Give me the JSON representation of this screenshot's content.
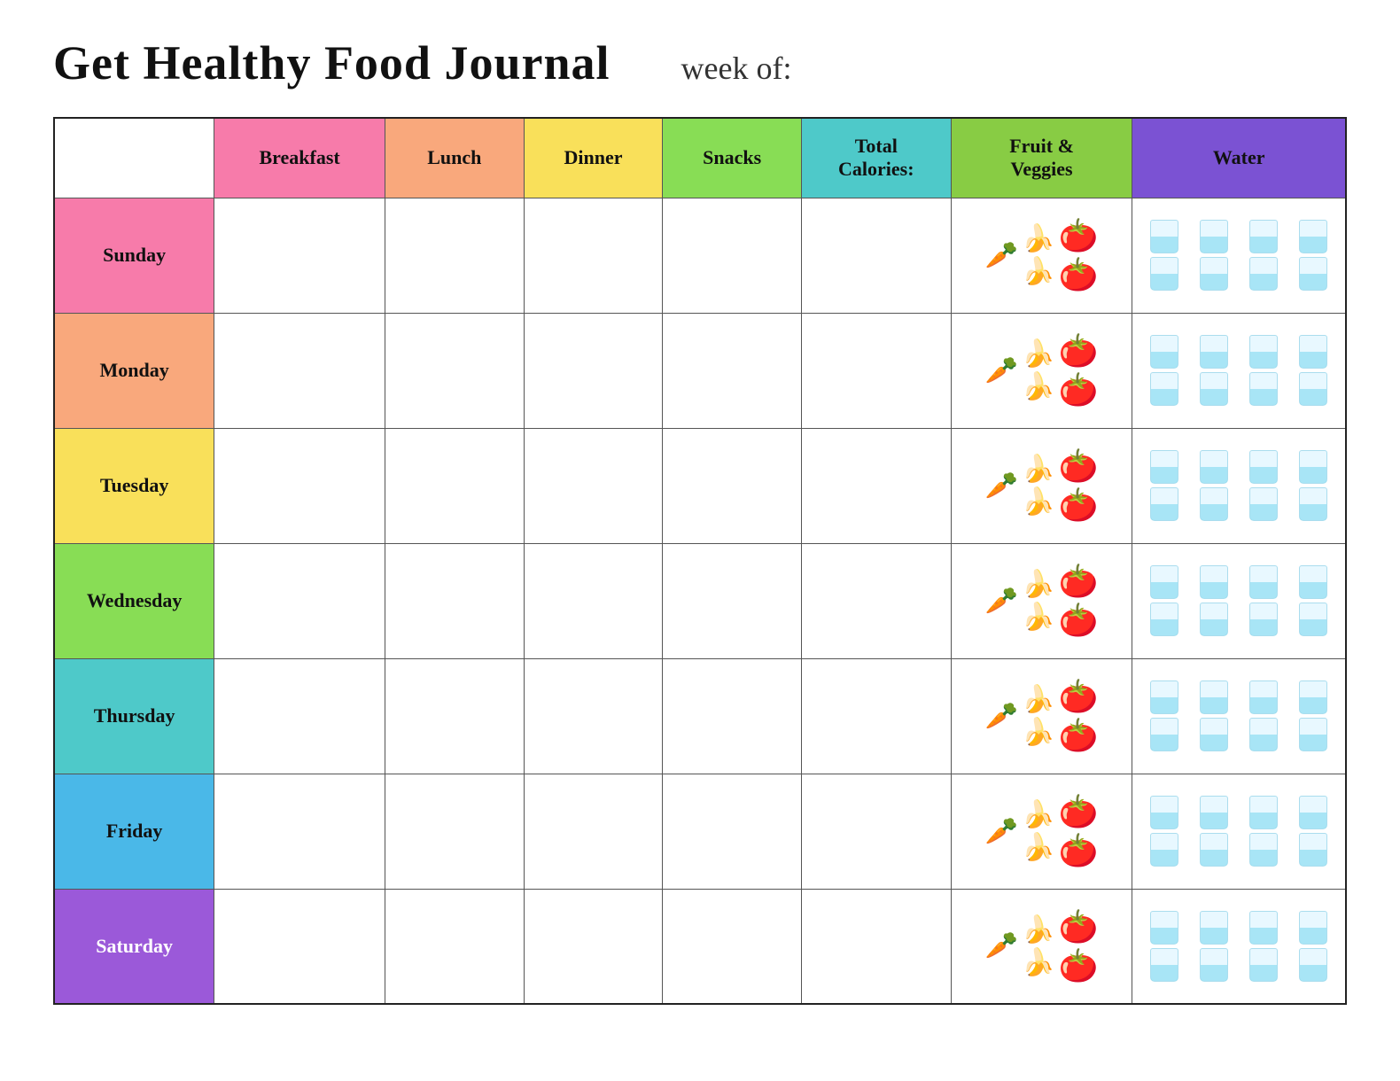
{
  "header": {
    "title": "Get Healthy Food Journal",
    "week_label": "week of:"
  },
  "columns": {
    "empty": "",
    "breakfast": "Breakfast",
    "lunch": "Lunch",
    "dinner": "Dinner",
    "snacks": "Snacks",
    "calories": "Total Calories:",
    "fv": "Fruit & Veggies",
    "water": "Water"
  },
  "days": [
    {
      "name": "Sunday",
      "class": "day-sunday"
    },
    {
      "name": "Monday",
      "class": "day-monday"
    },
    {
      "name": "Tuesday",
      "class": "day-tuesday"
    },
    {
      "name": "Wednesday",
      "class": "day-wednesday"
    },
    {
      "name": "Thursday",
      "class": "day-thursday"
    },
    {
      "name": "Friday",
      "class": "day-friday"
    },
    {
      "name": "Saturday",
      "class": "day-saturday"
    }
  ],
  "water_count": 8
}
